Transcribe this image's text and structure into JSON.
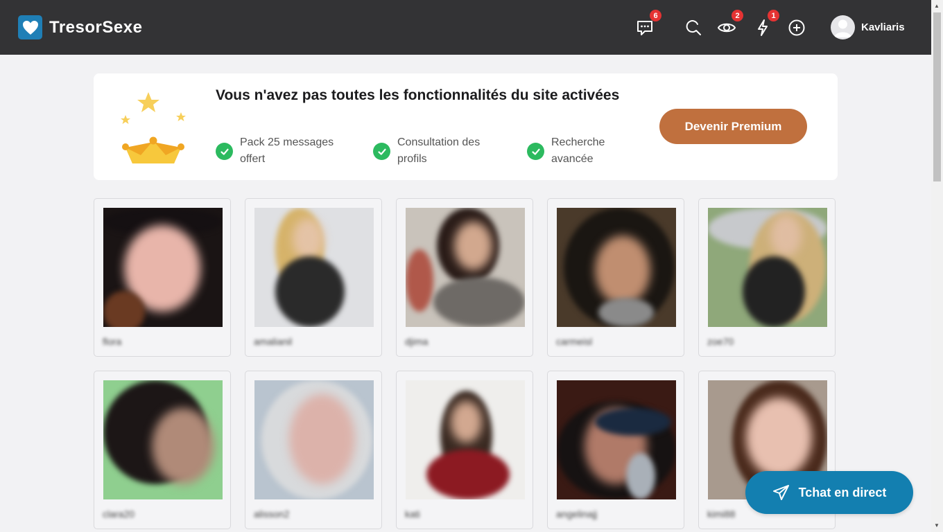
{
  "header": {
    "brand": "TresorSexe",
    "messages_badge": "6",
    "views_badge": "2",
    "flash_badge": "1",
    "username": "Kavliaris",
    "icons": [
      "chat-bubble-icon",
      "search-icon",
      "eye-icon",
      "lightning-icon",
      "plus-circle-icon",
      "avatar"
    ]
  },
  "banner": {
    "title": "Vous n'avez pas toutes les fonctionnalités du site activées",
    "features": [
      {
        "line1": "Pack 25 messages",
        "line2": "offert"
      },
      {
        "line1": "Consultation des",
        "line2": "profils"
      },
      {
        "line1": "Recherche",
        "line2": "avancée"
      }
    ],
    "cta": "Devenir Premium"
  },
  "profiles": [
    {
      "name": "flora"
    },
    {
      "name": "amalianil"
    },
    {
      "name": "djima"
    },
    {
      "name": "carmeisl"
    },
    {
      "name": "zoe70"
    },
    {
      "name": "clara20"
    },
    {
      "name": "alisson2"
    },
    {
      "name": "kati"
    },
    {
      "name": "angelinajj"
    },
    {
      "name": "kimi88"
    }
  ],
  "chat": {
    "label": "Tchat en direct"
  },
  "colors": {
    "header_bg": "#333335",
    "brand_blue": "#1f7fb6",
    "premium": "#c0703e",
    "chat": "#137fb0",
    "badge": "#e53333",
    "check": "#2cba5f"
  }
}
